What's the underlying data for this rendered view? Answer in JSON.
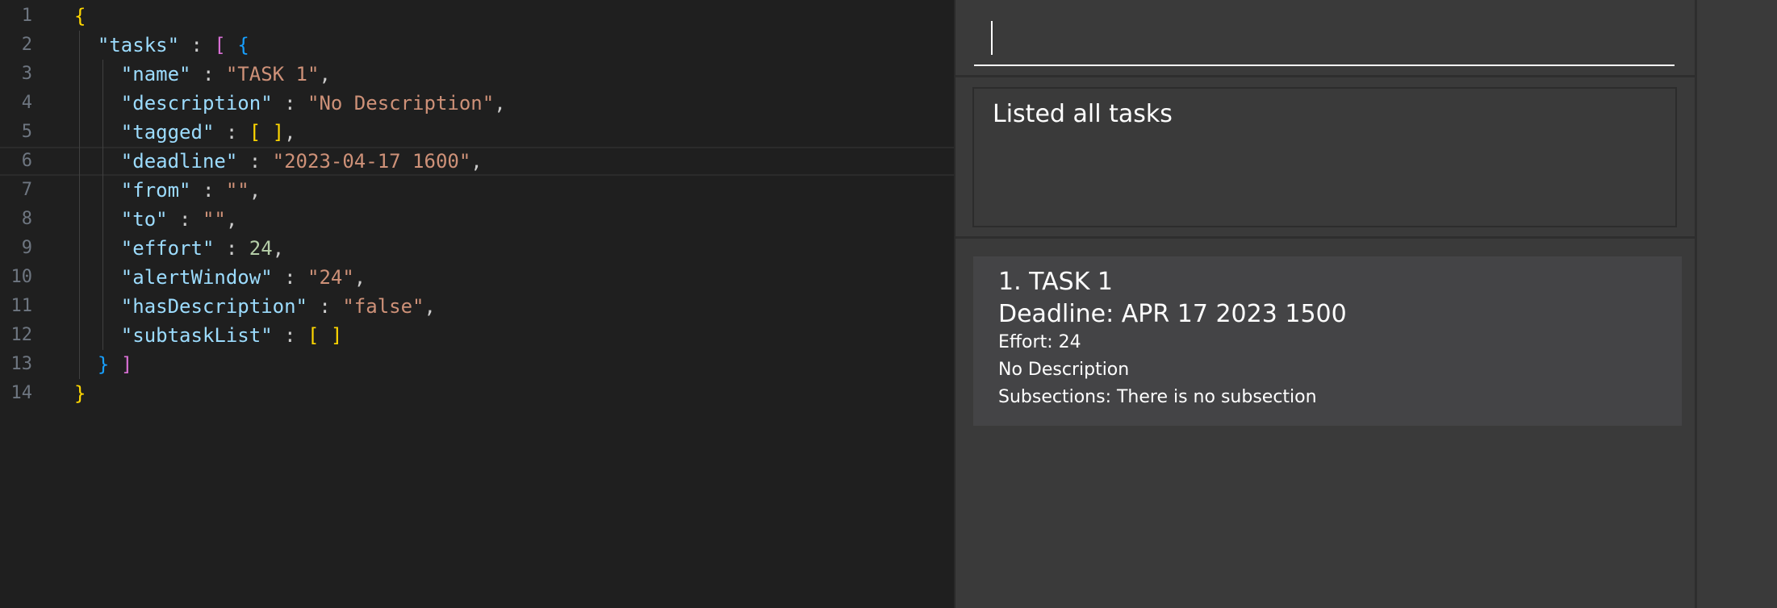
{
  "editor": {
    "lines": [
      {
        "num": "1",
        "tokens": [
          [
            "b1",
            "{"
          ]
        ]
      },
      {
        "num": "2",
        "tokens": [
          [
            "ind",
            "  "
          ],
          [
            "key",
            "\"tasks\""
          ],
          [
            "punc",
            " : "
          ],
          [
            "b2",
            "["
          ],
          [
            "punc",
            " "
          ],
          [
            "b3",
            "{"
          ]
        ]
      },
      {
        "num": "3",
        "tokens": [
          [
            "ind",
            "    "
          ],
          [
            "key",
            "\"name\""
          ],
          [
            "punc",
            " : "
          ],
          [
            "str",
            "\"TASK 1\""
          ],
          [
            "punc",
            ","
          ]
        ]
      },
      {
        "num": "4",
        "tokens": [
          [
            "ind",
            "    "
          ],
          [
            "key",
            "\"description\""
          ],
          [
            "punc",
            " : "
          ],
          [
            "str",
            "\"No Description\""
          ],
          [
            "punc",
            ","
          ]
        ]
      },
      {
        "num": "5",
        "tokens": [
          [
            "ind",
            "    "
          ],
          [
            "key",
            "\"tagged\""
          ],
          [
            "punc",
            " : "
          ],
          [
            "b1",
            "[ ]"
          ],
          [
            "punc",
            ","
          ]
        ]
      },
      {
        "num": "6",
        "tokens": [
          [
            "ind",
            "    "
          ],
          [
            "key",
            "\"deadline\""
          ],
          [
            "punc",
            " : "
          ],
          [
            "str",
            "\"2023-04-17 1600\""
          ],
          [
            "punc",
            ","
          ]
        ],
        "active": true
      },
      {
        "num": "7",
        "tokens": [
          [
            "ind",
            "    "
          ],
          [
            "key",
            "\"from\""
          ],
          [
            "punc",
            " : "
          ],
          [
            "str",
            "\"\""
          ],
          [
            "punc",
            ","
          ]
        ]
      },
      {
        "num": "8",
        "tokens": [
          [
            "ind",
            "    "
          ],
          [
            "key",
            "\"to\""
          ],
          [
            "punc",
            " : "
          ],
          [
            "str",
            "\"\""
          ],
          [
            "punc",
            ","
          ]
        ]
      },
      {
        "num": "9",
        "tokens": [
          [
            "ind",
            "    "
          ],
          [
            "key",
            "\"effort\""
          ],
          [
            "punc",
            " : "
          ],
          [
            "num",
            "24"
          ],
          [
            "punc",
            ","
          ]
        ]
      },
      {
        "num": "10",
        "tokens": [
          [
            "ind",
            "    "
          ],
          [
            "key",
            "\"alertWindow\""
          ],
          [
            "punc",
            " : "
          ],
          [
            "str",
            "\"24\""
          ],
          [
            "punc",
            ","
          ]
        ]
      },
      {
        "num": "11",
        "tokens": [
          [
            "ind",
            "    "
          ],
          [
            "key",
            "\"hasDescription\""
          ],
          [
            "punc",
            " : "
          ],
          [
            "str",
            "\"false\""
          ],
          [
            "punc",
            ","
          ]
        ]
      },
      {
        "num": "12",
        "tokens": [
          [
            "ind",
            "    "
          ],
          [
            "key",
            "\"subtaskList\""
          ],
          [
            "punc",
            " : "
          ],
          [
            "b1",
            "[ ]"
          ]
        ]
      },
      {
        "num": "13",
        "tokens": [
          [
            "ind",
            "  "
          ],
          [
            "b3",
            "}"
          ],
          [
            "punc",
            " "
          ],
          [
            "b2",
            "]"
          ]
        ]
      },
      {
        "num": "14",
        "tokens": [
          [
            "b1",
            "}"
          ]
        ]
      }
    ]
  },
  "app": {
    "command_input": {
      "value": "",
      "placeholder": ""
    },
    "result_message": "Listed all tasks",
    "tasks": [
      {
        "index_title": "1.  TASK 1",
        "deadline": "Deadline: APR 17 2023 1500",
        "effort": "Effort: 24",
        "description": "No Description",
        "subsections": "Subsections: There is no subsection"
      }
    ]
  },
  "colors": {
    "editor_bg": "#1f1f1f",
    "app_bg": "#3a3a3a",
    "card_bg": "#444446",
    "json_key": "#9cdcfe",
    "json_string": "#ce9178",
    "json_number": "#b5cea8",
    "bracket_gold": "#ffd700",
    "bracket_orchid": "#da70d6",
    "bracket_blue": "#179fff"
  }
}
